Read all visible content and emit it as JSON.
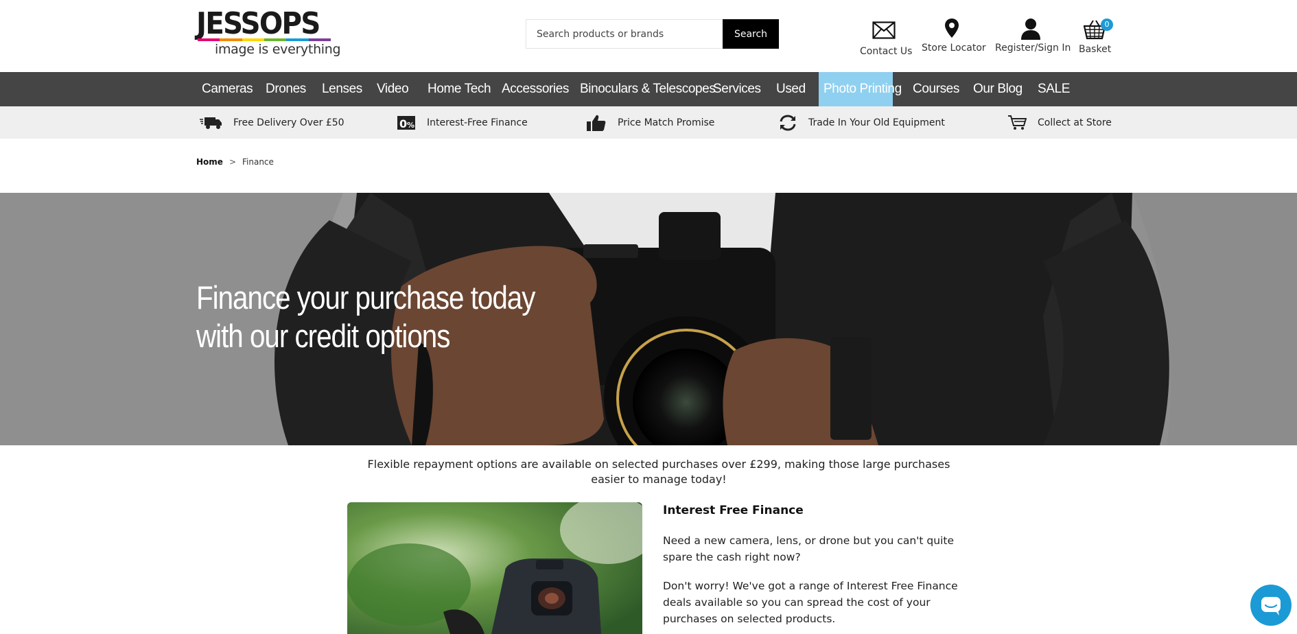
{
  "logo": {
    "wordmark": "JESSOPS",
    "tagline": "image is everything",
    "stripe_colors": [
      "#e4006f",
      "#f08a00",
      "#ffd600",
      "#6cb52d",
      "#1b9ad6",
      "#7b3f98"
    ]
  },
  "search": {
    "placeholder": "Search products or brands",
    "button_label": "Search"
  },
  "header_links": {
    "contact": "Contact Us",
    "store": "Store Locator",
    "account": "Register/Sign In",
    "basket": "Basket",
    "basket_count": "0"
  },
  "nav": [
    "Cameras",
    "Drones",
    "Lenses",
    "Video",
    "Home Tech",
    "Accessories",
    "Binoculars & Telescopes",
    "Services",
    "Used",
    "Photo Printing",
    "Courses",
    "Our Blog",
    "SALE"
  ],
  "nav_active": "Photo Printing",
  "usp": [
    "Free Delivery Over £50",
    "Interest-Free Finance",
    "Price Match Promise",
    "Trade In Your Old Equipment",
    "Collect at Store"
  ],
  "breadcrumb": {
    "home": "Home",
    "separator": ">",
    "current": "Finance"
  },
  "hero": {
    "line1": "Finance your purchase today",
    "line2": "with our credit options"
  },
  "intro": "Flexible repayment options are available on selected purchases over £299, making those large purchases easier to manage today!",
  "section": {
    "heading": "Interest Free Finance",
    "para1": "Need a new camera, lens, or drone but you can't quite spare the cash right now?",
    "para2": "Don't worry! We've got a range of Interest Free Finance deals available so you can spread the cost of your purchases on selected products."
  },
  "colors": {
    "nav_bg": "#454545",
    "nav_active_bg": "#8fd0f0",
    "usp_bg": "#efefef",
    "accent": "#1b9ad6"
  }
}
